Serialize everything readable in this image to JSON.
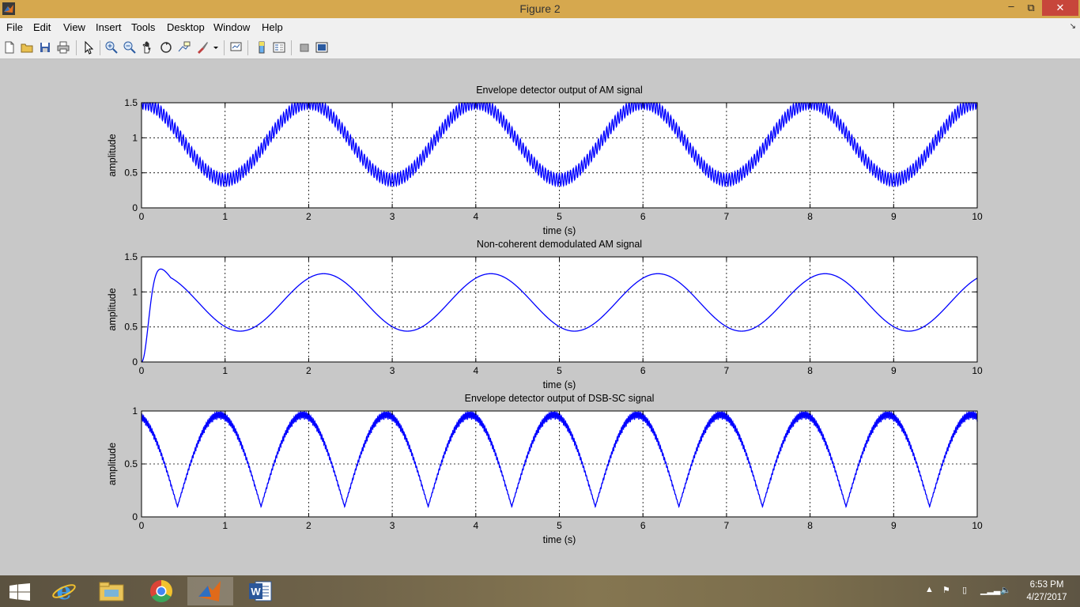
{
  "window": {
    "title": "Figure 2",
    "minimize_glyph": "–",
    "restore_glyph": "⧉",
    "close_glyph": "✕"
  },
  "menu": {
    "items": [
      "File",
      "Edit",
      "View",
      "Insert",
      "Tools",
      "Desktop",
      "Window",
      "Help"
    ],
    "dock_glyph": "↘"
  },
  "toolbar": {
    "buttons": [
      "new-figure",
      "open-file",
      "save",
      "print",
      "edit-plot-arrow",
      "zoom-in",
      "zoom-out",
      "pan",
      "rotate-3d",
      "data-cursor",
      "brush",
      "link-plot",
      "colorbar",
      "legend",
      "hide-plot-tools",
      "show-plot-tools"
    ]
  },
  "chart_data": [
    {
      "type": "line",
      "title": "Envelope detector output of AM signal",
      "xlabel": "time (s)",
      "ylabel": "amplitude",
      "xlim": [
        0,
        10
      ],
      "ylim": [
        0,
        1.5
      ],
      "xticks": [
        0,
        1,
        2,
        3,
        4,
        5,
        6,
        7,
        8,
        9,
        10
      ],
      "yticks": [
        0,
        0.5,
        1,
        1.5
      ],
      "grid": true,
      "series": [
        {
          "color": "#0000ff",
          "description": "0.95+0.55*cos(pi*t) with ~0.09 ripple at ~30 Hz",
          "x_start": 0,
          "x_end": 10,
          "mean": 0.95,
          "amplitude": 0.55,
          "period": 2,
          "ripple": 0.09,
          "ripple_freq": 30
        }
      ]
    },
    {
      "type": "line",
      "title": "Non-coherent demodulated AM signal",
      "xlabel": "time (s)",
      "ylabel": "amplitude",
      "xlim": [
        0,
        10
      ],
      "ylim": [
        0,
        1.5
      ],
      "xticks": [
        0,
        1,
        2,
        3,
        4,
        5,
        6,
        7,
        8,
        9,
        10
      ],
      "yticks": [
        0,
        0.5,
        1,
        1.5
      ],
      "grid": true,
      "series": [
        {
          "color": "#0000ff",
          "description": "low-pass filtered sinusoid; peaks ~1.26 at t=2.18,4.18,6.18,8.18; troughs ~0.44 at t=1.18,3.18,5.18,7.18,9.18; rises from 0 to 1.22 by t=0.3",
          "x_start": 0,
          "x_end": 10,
          "mean": 0.85,
          "amplitude": 0.41,
          "period": 2,
          "phase_t": 0.18
        }
      ]
    },
    {
      "type": "line",
      "title": "Envelope detector output of DSB-SC signal",
      "xlabel": "time (s)",
      "ylabel": "amplitude",
      "xlim": [
        0,
        10
      ],
      "ylim": [
        0,
        1
      ],
      "xticks": [
        0,
        1,
        2,
        3,
        4,
        5,
        6,
        7,
        8,
        9,
        10
      ],
      "yticks": [
        0,
        0.5,
        1
      ],
      "grid": true,
      "series": [
        {
          "color": "#0000ff",
          "description": "rectified cosine |cos(pi*t)| envelope with ripple; peaks ~1 at integer t, minima ~0.08 near t=0.57+n",
          "x_start": 0,
          "x_end": 10,
          "period": 1
        }
      ]
    }
  ],
  "taskbar": {
    "apps": [
      "internet-explorer",
      "file-explorer",
      "chrome",
      "matlab",
      "word"
    ],
    "active_app": "matlab",
    "time": "6:53 PM",
    "date": "4/27/2017"
  }
}
